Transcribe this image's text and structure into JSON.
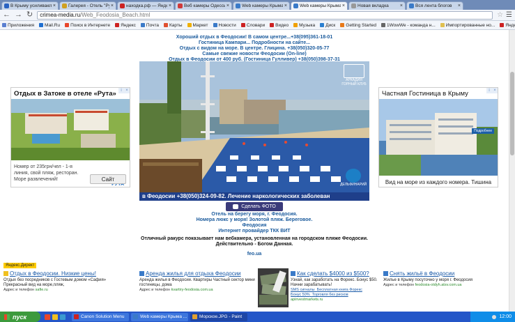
{
  "browser": {
    "tabs": [
      {
        "title": "В Крыму усиливаются",
        "color": "#2a63c2",
        "active": false
      },
      {
        "title": "Галерея - Отель \"Рута\"",
        "color": "#d0a020",
        "active": false
      },
      {
        "title": "находка.рф — Яндекс",
        "color": "#cc2222",
        "active": false
      },
      {
        "title": "Веб камеры Одессы",
        "color": "#d03a3a",
        "active": false
      },
      {
        "title": "Web камеры Крыма",
        "color": "#3a7ac8",
        "active": false
      },
      {
        "title": "Web камеры Крыма",
        "color": "#3a7ac8",
        "active": true
      },
      {
        "title": "Новая вкладка",
        "color": "#999999",
        "active": false
      },
      {
        "title": "Вся лента блогов",
        "color": "#3a7ac8",
        "active": false
      }
    ],
    "url_domain": "crimea-media.ru",
    "url_path": "/Web_Feodosia_Beach.html",
    "bookmarks": [
      {
        "label": "Приложения",
        "color": "#5a7fd0"
      },
      {
        "label": "Mail.Ru",
        "color": "#1f6fd0"
      },
      {
        "label": "Поиск в Интернете",
        "color": "#e8462b"
      },
      {
        "label": "Яндекс",
        "color": "#cc2222"
      },
      {
        "label": "Почта",
        "color": "#3a7ac8"
      },
      {
        "label": "Карты",
        "color": "#e05030"
      },
      {
        "label": "Маркет",
        "color": "#f0b000"
      },
      {
        "label": "Новости",
        "color": "#3a7ac8"
      },
      {
        "label": "Словари",
        "color": "#cc2222"
      },
      {
        "label": "Видео",
        "color": "#cc2222"
      },
      {
        "label": "Музыка",
        "color": "#f0a000"
      },
      {
        "label": "Диск",
        "color": "#2a7fd0"
      },
      {
        "label": "Getting Started",
        "color": "#e87a1a"
      },
      {
        "label": "1WowWe - команда н...",
        "color": "#666666"
      },
      {
        "label": "Импортированные но...",
        "color": "#e0c050"
      },
      {
        "label": "Яндекс",
        "color": "#cc2222"
      }
    ]
  },
  "headlines": [
    "Хороший отдых в Феодосии! В самом центре...+38(095)361-18-01",
    "Гостиница Кампари... Подробности на сайте...",
    "Отдых с видом на море. В центре. Глицина. +38(050)320-05-77",
    "Самые свежие новости Феодосии (On-line)",
    "Отдых в Феодосии от 400 руб. (Гостиница Гулливер) +38(050)398-37-31"
  ],
  "webcam": {
    "ticker": "в Феодосии +38(050)324-09-82.     Лечение наркологических заболеван",
    "logo_top": "АРКАДИЯ",
    "logo_top_sub": "ГОРНЫЙ КЛУБ",
    "logo_bottom": "ДЕЛЬФИНАРИЙ"
  },
  "photo_button": "Сделать ФОТО",
  "captions": [
    "Отель на берегу моря, г. Феодосия.",
    "Номера люкс у моря! Золотой пляж. Береговое.",
    "Феодосия",
    "Интернет провайдер ТКК ВИТ"
  ],
  "description": [
    "Отличный ракурс показывает нам вебкамера, установленная на городском пляже Феодосии.",
    "Действительно - Богом Данная."
  ],
  "footer_link": "feo.ua",
  "ad_left": {
    "title": "Отдых в Затоке в отеле «Рута»",
    "body": "Номер от 235грн/чел - 1-я линия, свой пляж, ресторан. Море развлечений!",
    "button": "Сайт",
    "logo": "РУТА"
  },
  "ad_right": {
    "title": "Частная Гостиница в  Крыму",
    "caption": "Вид на море из каждого номера. Тишина",
    "tag": "Подробнее"
  },
  "direct": {
    "label": "Яндекс.Директ",
    "items": [
      {
        "title": "Отдых в Феодосии. Низкие цены!",
        "text": "Отдых без посредников с Гостевым домом «Сафия» Прекрасный вид на море,пляж,",
        "link_label": "Адрес и телефон",
        "link": "safie.ru",
        "icon_color": "#f0c020"
      },
      {
        "title": "Аренда жилья для отдыха Феодосии",
        "text": "Аренда жилья в Феодосии. Квартиры Частный сектор мини гостиницы, дома",
        "link_label": "Адрес и телефон",
        "link": "kvartiry-feodosia.com.ua",
        "icon_color": "#3a7ac8"
      },
      {
        "title": "Как сделать $4000 из $500?",
        "text": "Узнай, как заработать на Форекс. Бонус $50. Начни зарабатывать!",
        "sub1": "SMS сигналы",
        "sub2": "Бесплатная книга Форекс",
        "sub3": "Бонус 50%",
        "sub4": "Торговля без рисков",
        "link": "apinvestmarkets.ru",
        "icon_color": "#3a7ac8"
      },
      {
        "title": "Снять жильё в Феодосии",
        "text": "Жилье в Крыму посуточно у моря г. Феодосия",
        "link_label": "Адрес и телефон",
        "link": "feodosia-otdyh.atsv.com.ua",
        "icon_color": "#3a7ac8"
      }
    ]
  },
  "taskbar": {
    "start": "пуск",
    "tasks": [
      {
        "label": "Canon Solution Menu",
        "color": "#cc2222",
        "active": false
      },
      {
        "label": "Web камеры Крыма ...",
        "color": "#3a7ac8",
        "active": false
      },
      {
        "label": "Морское.JPG - Paint",
        "color": "#e0a030",
        "active": true
      }
    ],
    "clock": "12:00"
  }
}
